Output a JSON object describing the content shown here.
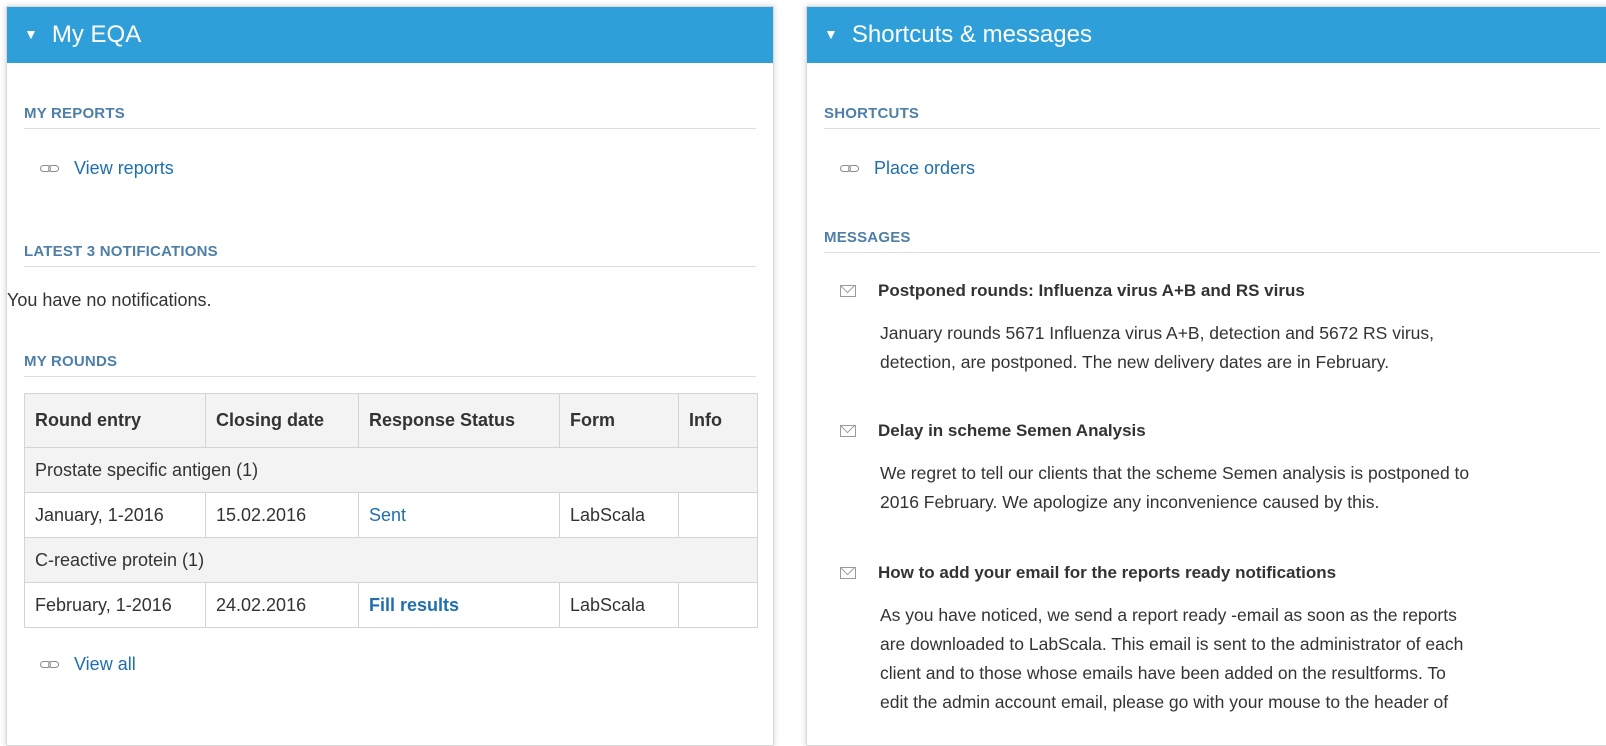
{
  "left_panel": {
    "title": "My EQA",
    "my_reports": {
      "heading": "MY REPORTS",
      "link": "View reports"
    },
    "notifications": {
      "heading": "LATEST 3 NOTIFICATIONS",
      "empty_text": "You have no notifications."
    },
    "my_rounds": {
      "heading": "MY ROUNDS",
      "columns": [
        "Round entry",
        "Closing date",
        "Response Status",
        "Form",
        "Info"
      ],
      "groups": [
        {
          "name": "Prostate specific antigen (1)",
          "rows": [
            {
              "round": "January, 1-2016",
              "closing": "15.02.2016",
              "status": "Sent",
              "form": "LabScala",
              "info": ""
            }
          ]
        },
        {
          "name": "C-reactive protein (1)",
          "rows": [
            {
              "round": "February, 1-2016",
              "closing": "24.02.2016",
              "status": "Fill results",
              "form": "LabScala",
              "info": ""
            }
          ]
        }
      ],
      "view_all": "View all"
    }
  },
  "right_panel": {
    "title": "Shortcuts & messages",
    "shortcuts": {
      "heading": "SHORTCUTS",
      "link": "Place orders"
    },
    "messages": {
      "heading": "MESSAGES",
      "items": [
        {
          "title": "Postponed rounds: Influenza virus A+B and RS virus",
          "lines": [
            "January rounds 5671 Influenza virus A+B, detection and 5672 RS virus,",
            "detection, are postponed. The new delivery dates are in February."
          ]
        },
        {
          "title": "Delay in scheme Semen Analysis",
          "lines": [
            "We regret to tell our clients that the scheme Semen analysis is postponed to",
            "2016 February. We apologize any inconvenience caused by this."
          ]
        },
        {
          "title": "How to add your email for the reports ready notifications",
          "lines": [
            "As you have noticed, we send a report ready -email as soon as the reports",
            "are downloaded to LabScala. This email is sent to the administrator of each",
            "client and to those whose emails have been added on the resultforms. To",
            "edit the admin account email, please go with your mouse to the header of"
          ]
        }
      ]
    }
  },
  "colors": {
    "header_bg": "#2e9fd8",
    "link": "#1f6fae",
    "section_heading": "#4d7fa8"
  }
}
